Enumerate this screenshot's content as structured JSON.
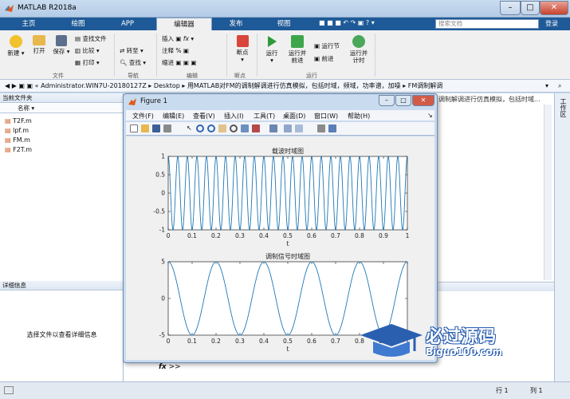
{
  "window": {
    "title": "MATLAB R2018a",
    "controls": [
      "–",
      "□",
      "✕"
    ]
  },
  "tabs": [
    {
      "label": "主页"
    },
    {
      "label": "绘图"
    },
    {
      "label": "APP"
    },
    {
      "label": "编辑器"
    },
    {
      "label": "发布"
    },
    {
      "label": "视图"
    }
  ],
  "search": {
    "placeholder": "搜索文档",
    "login": "登录"
  },
  "ribbon": {
    "new": "新建",
    "open": "打开",
    "save": "保存",
    "find_files": "查找文件",
    "compare": "比较",
    "print": "打印",
    "goto": "转至",
    "find": "查找",
    "insert": "插入",
    "comment": "注释",
    "indent": "缩进",
    "breakpoints": "断点",
    "run": "运行",
    "run_advance_1": "运行并",
    "run_advance_2": "前进",
    "run_section": "运行节",
    "advance": "前进",
    "run_time_1": "运行并",
    "run_time_2": "计时",
    "groups": {
      "file": "文件",
      "navigate": "导航",
      "edit": "编辑",
      "breakpoints": "断点",
      "run": "运行"
    }
  },
  "address": {
    "prefix": "«",
    "path": [
      "Administrator.WIN7U-20180127Z",
      "Desktop",
      "用MATLAB对FM的调制解调进行仿真模拟，包括时域，频域，功率谱，加噪",
      "FM调制解调"
    ]
  },
  "current_folder": {
    "title": "当前文件夹",
    "column": "名称",
    "files": [
      "T2F.m",
      "lpf.m",
      "FM.m",
      "F2T.m"
    ]
  },
  "details": {
    "title": "详细信息",
    "message": "选择文件以查看详细信息"
  },
  "workspace_tab": "工作区",
  "editor_title_fragment": "调制解调进行仿真模拟，包括时域...",
  "command_prompt": ">>",
  "status": {
    "row_label": "行",
    "row": "1",
    "col_label": "列",
    "col": "1"
  },
  "figure": {
    "title": "Figure 1",
    "menus": [
      "文件(F)",
      "编辑(E)",
      "查看(V)",
      "插入(I)",
      "工具(T)",
      "桌面(D)",
      "窗口(W)",
      "帮助(H)"
    ]
  },
  "chart_data": [
    {
      "type": "line",
      "title": "载波时域图",
      "xlabel": "t",
      "ylabel": "",
      "xlim": [
        0,
        1
      ],
      "ylim": [
        -1,
        1
      ],
      "xticks": [
        "0",
        "0.1",
        "0.2",
        "0.3",
        "0.4",
        "0.5",
        "0.6",
        "0.7",
        "0.8",
        "0.9",
        "1"
      ],
      "yticks": [
        "-1",
        "-0.5",
        "0",
        "0.5",
        "1"
      ],
      "series": [
        {
          "function": "cos(2*pi*25*t)",
          "color": "#1f77b4"
        }
      ]
    },
    {
      "type": "line",
      "title": "调制信号时域图",
      "xlabel": "t",
      "ylabel": "",
      "xlim": [
        0,
        1
      ],
      "ylim": [
        -5,
        5
      ],
      "xticks": [
        "0",
        "0.1",
        "0.2",
        "0.3",
        "0.4",
        "0.5",
        "0.6",
        "0.7",
        "0.8",
        "0.9",
        "1"
      ],
      "yticks": [
        "-5",
        "0",
        "5"
      ],
      "series": [
        {
          "function": "5*cos(2*pi*5*t)",
          "color": "#1f77b4"
        }
      ]
    }
  ],
  "watermark": {
    "brand": "必过源码",
    "url": "Biguo100.com"
  }
}
